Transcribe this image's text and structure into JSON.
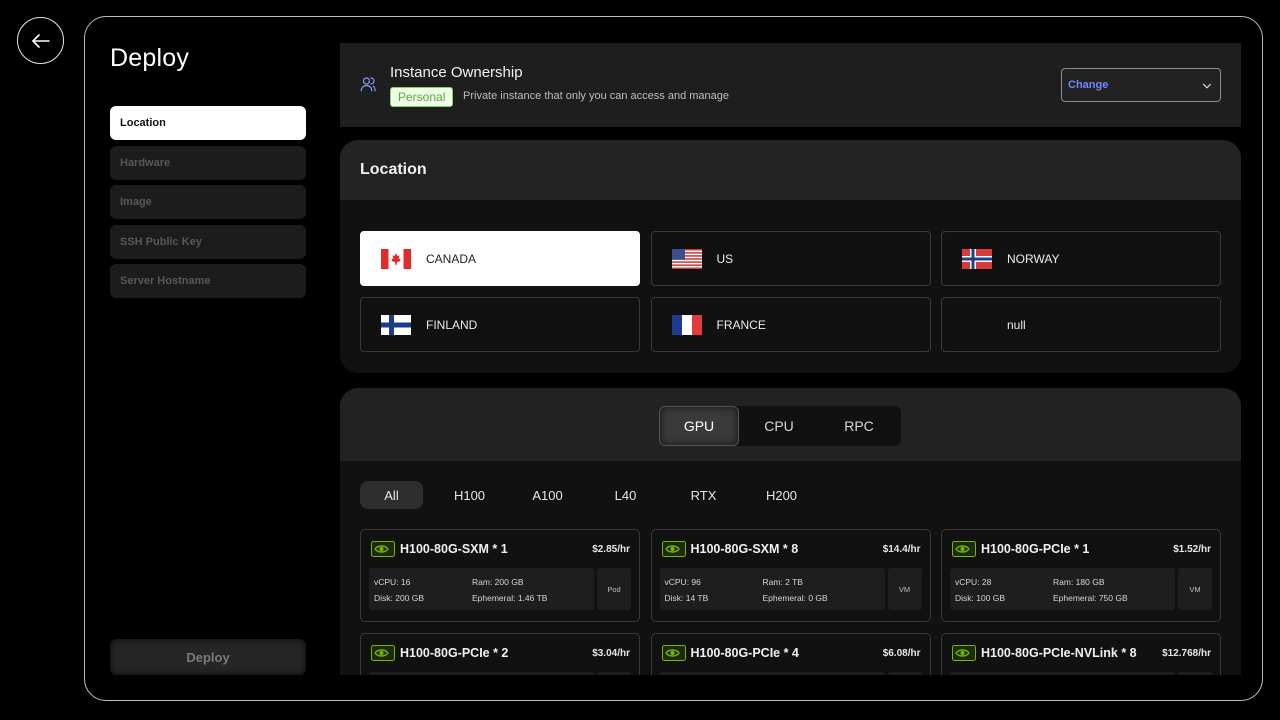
{
  "page": {
    "title": "Deploy"
  },
  "steps": [
    {
      "label": "Location",
      "active": true
    },
    {
      "label": "Hardware",
      "active": false
    },
    {
      "label": "Image",
      "active": false
    },
    {
      "label": "SSH Public Key",
      "active": false
    },
    {
      "label": "Server Hostname",
      "active": false
    }
  ],
  "deploy_button": "Deploy",
  "ownership": {
    "title": "Instance Ownership",
    "badge": "Personal",
    "description": "Private instance that only you can access and manage",
    "change_label": "Change"
  },
  "location": {
    "heading": "Location",
    "items": [
      {
        "name": "CANADA",
        "flag": "canada-flag",
        "selected": true
      },
      {
        "name": "US",
        "flag": "us-flag",
        "selected": false
      },
      {
        "name": "NORWAY",
        "flag": "norway-flag",
        "selected": false
      },
      {
        "name": "FINLAND",
        "flag": "finland-flag",
        "selected": false
      },
      {
        "name": "FRANCE",
        "flag": "france-flag",
        "selected": false
      },
      {
        "name": "null",
        "flag": "",
        "selected": false
      }
    ]
  },
  "hardware": {
    "tabs": [
      {
        "label": "GPU",
        "active": true
      },
      {
        "label": "CPU",
        "active": false
      },
      {
        "label": "RPC",
        "active": false
      }
    ],
    "filters": [
      {
        "label": "All",
        "active": true
      },
      {
        "label": "H100",
        "active": false
      },
      {
        "label": "A100",
        "active": false
      },
      {
        "label": "L40",
        "active": false
      },
      {
        "label": "RTX",
        "active": false
      },
      {
        "label": "H200",
        "active": false
      }
    ],
    "gpus": [
      {
        "name": "H100-80G-SXM * 1",
        "price": "$2.85/hr",
        "vcpu": "vCPU: 16",
        "ram": "Ram: 200 GB",
        "disk": "Disk: 200 GB",
        "ephemeral": "Ephemeral: 1.46 TB",
        "type": "Pod"
      },
      {
        "name": "H100-80G-SXM * 8",
        "price": "$14.4/hr",
        "vcpu": "vCPU: 96",
        "ram": "Ram: 2 TB",
        "disk": "Disk: 14 TB",
        "ephemeral": "Ephemeral: 0 GB",
        "type": "VM"
      },
      {
        "name": "H100-80G-PCIe * 1",
        "price": "$1.52/hr",
        "vcpu": "vCPU: 28",
        "ram": "Ram: 180 GB",
        "disk": "Disk: 100 GB",
        "ephemeral": "Ephemeral: 750 GB",
        "type": "VM"
      },
      {
        "name": "H100-80G-PCIe * 2",
        "price": "$3.04/hr",
        "vcpu": "",
        "ram": "",
        "disk": "",
        "ephemeral": "",
        "type": ""
      },
      {
        "name": "H100-80G-PCIe * 4",
        "price": "$6.08/hr",
        "vcpu": "",
        "ram": "",
        "disk": "",
        "ephemeral": "",
        "type": ""
      },
      {
        "name": "H100-80G-PCIe-NVLink * 8",
        "price": "$12.768/hr",
        "vcpu": "",
        "ram": "",
        "disk": "",
        "ephemeral": "",
        "type": ""
      }
    ]
  },
  "colors": {
    "accent_link": "#6f86ff",
    "badge_green": "#52a83a",
    "nvidia_green": "#76b900"
  }
}
